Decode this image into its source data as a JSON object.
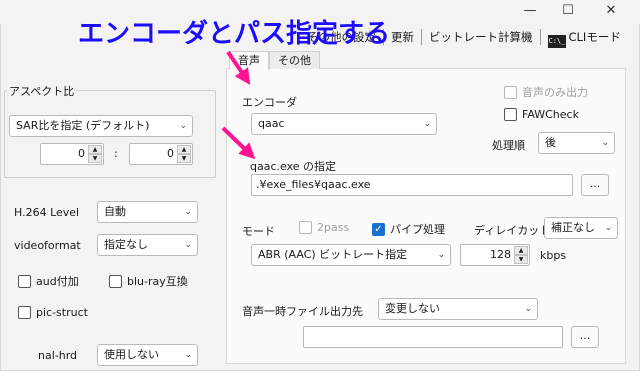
{
  "annotation": {
    "text": "エンコーダとパス指定する",
    "color": "#1c0bff",
    "arrow_color": "#ff1493"
  },
  "window": {
    "min_icon": "minimize-icon",
    "max_icon": "maximize-icon",
    "close_icon": "close-icon"
  },
  "toolbar": {
    "other_settings": "その他の設定",
    "update": "更新",
    "bitrate_calc": "ビットレート計算機",
    "cli_mode": "CLIモード",
    "cli_icon_text": "C:\\_"
  },
  "left": {
    "aspect_group_title": "アスペクト比",
    "sar_select": "SAR比を指定 (デフォルト)",
    "sar_w": "0",
    "sar_sep": ":",
    "sar_h": "0",
    "h264_level_label": "H.264 Level",
    "h264_level_value": "自動",
    "videoformat_label": "videoformat",
    "videoformat_value": "指定なし",
    "aud_label": "aud付加",
    "bluray_label": "blu-ray互換",
    "picstruct_label": "pic-struct",
    "nalhrd_label": "nal-hrd",
    "nalhrd_value": "使用しない"
  },
  "tabs": [
    {
      "label": "音声",
      "active": true
    },
    {
      "label": "その他",
      "active": false
    }
  ],
  "audio": {
    "encoder_label": "エンコーダ",
    "encoder_value": "qaac",
    "audio_only_label": "音声のみ出力",
    "fawcheck_label": "FAWCheck",
    "order_label": "処理順",
    "order_value": "後",
    "exe_label": "qaac.exe の指定",
    "exe_path": ".¥exe_files¥qaac.exe",
    "browse_label": "...",
    "mode_label": "モード",
    "twopass_label": "2pass",
    "pipe_label": "パイプ処理",
    "delay_label": "ディレイカット",
    "delay_value": "補正なし",
    "mode_value": "ABR (AAC) ビットレート指定",
    "bitrate_value": "128",
    "bitrate_unit": "kbps",
    "temp_label": "音声一時ファイル出力先",
    "temp_value": "変更しない",
    "temp_path": "",
    "temp_browse_label": "..."
  }
}
